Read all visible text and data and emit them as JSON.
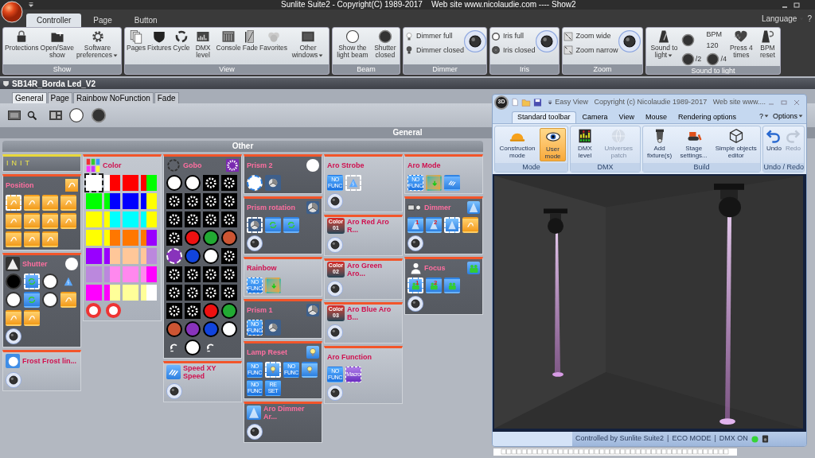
{
  "app": {
    "title": "Sunlite Suite2 - Copyright(C) 1989-2017    Web site www.nicolaudie.com ---- Show2"
  },
  "ribbon": {
    "tabs": [
      {
        "label": "Controller",
        "selected": true
      },
      {
        "label": "Page",
        "selected": false
      },
      {
        "label": "Button",
        "selected": false
      }
    ],
    "language": "Language",
    "help": "?",
    "groups": [
      {
        "label": "Show",
        "items": [
          {
            "kind": "button",
            "label": "Protections"
          },
          {
            "kind": "button",
            "label": "Open/Save show"
          },
          {
            "kind": "button",
            "label": "Software preferences",
            "dropdown": true
          }
        ]
      },
      {
        "label": "View",
        "items": [
          {
            "kind": "button",
            "label": "Pages"
          },
          {
            "kind": "button",
            "label": "Fixtures"
          },
          {
            "kind": "button",
            "label": "Cycle"
          },
          {
            "kind": "button",
            "label": "DMX level"
          },
          {
            "kind": "button",
            "label": "Console"
          },
          {
            "kind": "button",
            "label": "Fade"
          },
          {
            "kind": "button",
            "label": "Favorites"
          },
          {
            "kind": "button",
            "label": "Other windows",
            "dropdown": true
          }
        ]
      },
      {
        "label": "Beam",
        "items": [
          {
            "kind": "button",
            "label": "Show the light beam"
          },
          {
            "kind": "button",
            "label": "Shutter closed"
          }
        ]
      },
      {
        "label": "Dimmer",
        "items": [
          {
            "kind": "rows",
            "rows": [
              "Dimmer full",
              "Dimmer closed"
            ]
          },
          {
            "kind": "knob"
          }
        ]
      },
      {
        "label": "Iris",
        "items": [
          {
            "kind": "rows",
            "rows": [
              "Iris full",
              "Iris closed"
            ]
          },
          {
            "kind": "knob"
          }
        ]
      },
      {
        "label": "Zoom",
        "items": [
          {
            "kind": "rows",
            "rows": [
              "Zoom wide",
              "Zoom narrow"
            ]
          },
          {
            "kind": "knob"
          }
        ]
      },
      {
        "label": "Sound to light",
        "items": [
          {
            "kind": "button",
            "label": "Sound to light",
            "dropdown": true
          },
          {
            "kind": "beat",
            "bpm": "BPM 120",
            "half": "/2",
            "quarter": "/4"
          },
          {
            "kind": "button",
            "label": "Press 4 times"
          },
          {
            "kind": "button",
            "label": "BPM reset"
          }
        ]
      }
    ]
  },
  "document": {
    "title": "SB14R_Borda Led_V2",
    "tabs": [
      {
        "label": "General",
        "selected": true
      },
      {
        "label": "Page",
        "selected": false
      },
      {
        "label": "Rainbow NoFunction",
        "selected": false
      },
      {
        "label": "Fade",
        "selected": false
      }
    ],
    "section": "General",
    "group": "Other",
    "columns": [
      [
        {
          "kind": "label",
          "title": "INIT"
        },
        {
          "kind": "panel",
          "title": "Position",
          "highlighted": true,
          "knob": false,
          "items": [
            {
              "kind": "orange",
              "selected": true
            },
            {
              "kind": "orange",
              "selected": false
            },
            {
              "kind": "orange",
              "selected": false
            },
            {
              "kind": "orange",
              "selected": false
            },
            {
              "kind": "orange",
              "selected": false
            },
            {
              "kind": "orange",
              "selected": false
            },
            {
              "kind": "orange",
              "selected": false
            },
            {
              "kind": "orange",
              "selected": false
            },
            {
              "kind": "orange",
              "selected": false
            },
            {
              "kind": "orange",
              "selected": false
            },
            {
              "kind": "orange",
              "selected": false
            }
          ]
        },
        {
          "kind": "panel",
          "title": "Shutter",
          "highlighted": true,
          "knob": true,
          "items": [
            {
              "kind": "black",
              "selected": false
            },
            {
              "kind": "cycle",
              "selected": true
            },
            {
              "kind": "white",
              "selected": false
            },
            {
              "kind": "flash",
              "selected": false
            },
            {
              "kind": "white",
              "selected": false
            },
            {
              "kind": "cycle",
              "selected": false
            },
            {
              "kind": "white",
              "selected": false
            },
            {
              "kind": "orange",
              "selected": false
            },
            {
              "kind": "orange",
              "selected": false
            },
            {
              "kind": "orange",
              "selected": false
            }
          ]
        },
        {
          "kind": "panel",
          "title": "Frost Frost lin...",
          "highlighted": false,
          "knob": true
        }
      ],
      [
        {
          "kind": "panel",
          "title": "Color",
          "highlighted": false,
          "knob": false,
          "items": [
            {
              "kind": "swatch",
              "color": "#ffffff",
              "selected": true
            },
            {
              "kind": "split",
              "color": "#ff0000",
              "selected": false
            },
            {
              "kind": "swatch",
              "color": "#ff0000",
              "selected": false
            },
            {
              "kind": "split",
              "color": "#00ff00",
              "selected": false
            },
            {
              "kind": "swatch",
              "color": "#00ff00",
              "selected": false
            },
            {
              "kind": "split",
              "color": "#0000ff",
              "selected": false
            },
            {
              "kind": "swatch",
              "color": "#0000ff",
              "selected": false
            },
            {
              "kind": "split",
              "color": "#ffff00",
              "selected": false
            },
            {
              "kind": "swatch",
              "color": "#ffff00",
              "selected": false
            },
            {
              "kind": "split",
              "color": "#00ffff",
              "selected": false
            },
            {
              "kind": "swatch",
              "color": "#00ffff",
              "selected": false
            },
            {
              "kind": "split",
              "color": "#ffff00",
              "selected": false
            },
            {
              "kind": "swatch",
              "color": "#ffff00",
              "selected": false
            },
            {
              "kind": "split",
              "color": "#ff7700",
              "selected": false
            },
            {
              "kind": "swatch",
              "color": "#ff7700",
              "selected": false
            },
            {
              "kind": "split",
              "color": "#9900ff",
              "selected": false
            },
            {
              "kind": "swatch",
              "color": "#9900ff",
              "selected": false
            },
            {
              "kind": "split",
              "color": "#ffc799",
              "selected": false
            },
            {
              "kind": "swatch",
              "color": "#ffc799",
              "selected": false
            },
            {
              "kind": "split",
              "color": "#bb88dd",
              "selected": false
            },
            {
              "kind": "swatch",
              "color": "#bb88dd",
              "selected": false
            },
            {
              "kind": "split",
              "color": "#ff88ee",
              "selected": false
            },
            {
              "kind": "swatch",
              "color": "#ff88ee",
              "selected": false
            },
            {
              "kind": "split",
              "color": "#ff00ff",
              "selected": false
            },
            {
              "kind": "swatch",
              "color": "#ff00ff",
              "selected": false
            },
            {
              "kind": "split",
              "color": "#ffff99",
              "selected": false
            },
            {
              "kind": "swatch",
              "color": "#ffff99",
              "selected": false
            },
            {
              "kind": "split",
              "color": "#ffffff",
              "selected": false
            },
            {
              "kind": "rainbow",
              "selected": false
            },
            {
              "kind": "rainbow",
              "selected": false
            }
          ]
        }
      ],
      [
        {
          "kind": "panel",
          "title": "Gobo",
          "highlighted": true,
          "knob": false,
          "items": [
            {
              "kind": "disc",
              "color": "#ffffff",
              "selected": false
            },
            {
              "kind": "disc",
              "color": "#ffffff",
              "selected": false
            },
            {
              "kind": "pattern",
              "selected": false
            },
            {
              "kind": "pattern",
              "selected": false
            },
            {
              "kind": "pattern",
              "selected": false
            },
            {
              "kind": "pattern",
              "selected": false
            },
            {
              "kind": "pattern",
              "selected": false
            },
            {
              "kind": "pattern",
              "selected": false
            },
            {
              "kind": "pattern",
              "selected": false
            },
            {
              "kind": "pattern",
              "selected": false
            },
            {
              "kind": "pattern",
              "selected": false
            },
            {
              "kind": "pattern",
              "selected": false
            },
            {
              "kind": "pattern",
              "selected": false
            },
            {
              "kind": "disc",
              "color": "#ee1111",
              "selected": false
            },
            {
              "kind": "disc",
              "color": "#22aa33",
              "selected": false
            },
            {
              "kind": "disc",
              "color": "#cc5533",
              "selected": false
            },
            {
              "kind": "disc",
              "color": "#8833bb",
              "selected": true
            },
            {
              "kind": "disc",
              "color": "#1144dd",
              "selected": false
            },
            {
              "kind": "disc",
              "color": "#ffffff",
              "selected": false
            },
            {
              "kind": "pattern",
              "selected": false
            },
            {
              "kind": "pattern",
              "selected": false
            },
            {
              "kind": "pattern",
              "selected": false
            },
            {
              "kind": "pattern",
              "selected": false
            },
            {
              "kind": "pattern",
              "selected": false
            },
            {
              "kind": "pattern",
              "selected": false
            },
            {
              "kind": "pattern",
              "selected": false
            },
            {
              "kind": "pattern",
              "selected": false
            },
            {
              "kind": "pattern",
              "selected": false
            },
            {
              "kind": "pattern",
              "selected": false
            },
            {
              "kind": "pattern",
              "selected": false
            },
            {
              "kind": "disc",
              "color": "#ee1111",
              "selected": false
            },
            {
              "kind": "disc",
              "color": "#22aa33",
              "selected": false
            },
            {
              "kind": "disc",
              "color": "#cc5533",
              "selected": false
            },
            {
              "kind": "disc",
              "color": "#8833bb",
              "selected": false
            },
            {
              "kind": "disc",
              "color": "#1144dd",
              "selected": false
            },
            {
              "kind": "disc",
              "color": "#ffffff",
              "selected": false
            },
            {
              "kind": "rotate",
              "selected": false
            },
            {
              "kind": "disc",
              "color": "#ffffff",
              "selected": false
            },
            {
              "kind": "rotate",
              "selected": false
            }
          ]
        },
        {
          "kind": "panel",
          "title": "Speed XY Speed",
          "highlighted": false,
          "knob": true
        }
      ],
      [
        {
          "kind": "panel",
          "title": "Prism 2",
          "highlighted": true,
          "knob": false,
          "items": [
            {
              "kind": "white",
              "selected": true
            },
            {
              "kind": "prism",
              "selected": false
            }
          ]
        },
        {
          "kind": "panel",
          "title": "Prism rotation",
          "highlighted": true,
          "knob": true,
          "items": [
            {
              "kind": "prism",
              "selected": true
            },
            {
              "kind": "cycle",
              "selected": false
            },
            {
              "kind": "cycle",
              "selected": false
            }
          ]
        },
        {
          "kind": "panel",
          "title": "Rainbow",
          "highlighted": false,
          "knob": false,
          "items": [
            {
              "kind": "nofunc",
              "label": "NO FUNC",
              "selected": true
            },
            {
              "kind": "gradient",
              "selected": false
            }
          ]
        },
        {
          "kind": "panel",
          "title": "Prism 1",
          "highlighted": true,
          "knob": false,
          "items": [
            {
              "kind": "nofunc",
              "label": "NO FUNC",
              "selected": true
            },
            {
              "kind": "prism",
              "selected": false
            }
          ]
        },
        {
          "kind": "panel",
          "title": "Lamp Reset",
          "highlighted": true,
          "knob": false,
          "items": [
            {
              "kind": "nofunc",
              "label": "NO FUNC",
              "selected": false
            },
            {
              "kind": "bulb",
              "selected": true
            },
            {
              "kind": "nofunc",
              "label": "NO FUNC",
              "selected": false
            },
            {
              "kind": "bulb",
              "selected": false
            },
            {
              "kind": "nofunc",
              "label": "NO FUNC",
              "selected": false
            },
            {
              "kind": "nofunc",
              "label": "RE SET",
              "selected": false
            }
          ]
        },
        {
          "kind": "panel",
          "title": "Aro Dimmer Ar...",
          "highlighted": true,
          "knob": true
        }
      ],
      [
        {
          "kind": "panel",
          "title": "Aro Strobe",
          "highlighted": false,
          "knob": true,
          "items": [
            {
              "kind": "nofunc",
              "label": "NO FUNC",
              "selected": false
            },
            {
              "kind": "flash",
              "selected": true
            }
          ]
        },
        {
          "kind": "panel",
          "title": "Aro Red Aro R...",
          "highlighted": false,
          "chip_label": "Color 01",
          "knob": true
        },
        {
          "kind": "panel",
          "title": "Aro Green Aro...",
          "highlighted": false,
          "chip_label": "Color 02",
          "knob": true
        },
        {
          "kind": "panel",
          "title": "Aro Blue Aro B...",
          "highlighted": false,
          "chip_label": "Color 03",
          "knob": true
        },
        {
          "kind": "panel",
          "title": "Aro Function",
          "highlighted": false,
          "knob": true,
          "items": [
            {
              "kind": "nofunc",
              "label": "NO FUNC",
              "selected": false
            },
            {
              "kind": "macro",
              "label": "Macro",
              "selected": true
            }
          ]
        }
      ],
      [
        {
          "kind": "panel",
          "title": "Aro Mode",
          "highlighted": false,
          "knob": false,
          "items": [
            {
              "kind": "nofunc",
              "label": "NO FUNC",
              "selected": true
            },
            {
              "kind": "gradient",
              "selected": false
            },
            {
              "kind": "layers",
              "selected": false
            }
          ]
        },
        {
          "kind": "panel",
          "title": "Dimmer",
          "highlighted": true,
          "knob": true,
          "items": [
            {
              "kind": "beam",
              "label": "1",
              "selected": false
            },
            {
              "kind": "beam",
              "label": "2",
              "selected": false
            },
            {
              "kind": "beam",
              "selected": true
            },
            {
              "kind": "orange",
              "selected": false
            }
          ]
        },
        {
          "kind": "panel",
          "title": "Focus",
          "highlighted": true,
          "knob": true,
          "items": [
            {
              "kind": "people",
              "label": "1",
              "selected": true
            },
            {
              "kind": "people",
              "label": "2",
              "selected": false
            },
            {
              "kind": "people",
              "selected": false
            }
          ]
        }
      ]
    ]
  },
  "easy_view": {
    "orb": "3D",
    "title": "Easy View   Copyright (c) Nicolaudie 1989-2017   Web site www....",
    "tabs": [
      {
        "label": "Standard toolbar",
        "selected": true
      },
      {
        "label": "Camera",
        "selected": false
      },
      {
        "label": "View",
        "selected": false
      },
      {
        "label": "Mouse",
        "selected": false
      },
      {
        "label": "Rendering options",
        "selected": false
      }
    ],
    "help": "?",
    "options": "Options",
    "groups": [
      {
        "label": "Mode",
        "items": [
          {
            "label": "Construction mode",
            "selected": false
          },
          {
            "label": "User mode",
            "selected": true
          }
        ]
      },
      {
        "label": "DMX",
        "items": [
          {
            "label": "DMX level",
            "disabled": false
          },
          {
            "label": "Universes patch",
            "disabled": true
          }
        ]
      },
      {
        "label": "Build",
        "items": [
          {
            "label": "Add fixture(s)"
          },
          {
            "label": "Stage settings..."
          },
          {
            "label": "Simple objects editor"
          }
        ]
      },
      {
        "label": "Undo / Redo",
        "items": [
          {
            "label": "Undo",
            "disabled": false
          },
          {
            "label": "Redo",
            "disabled": true
          }
        ]
      }
    ],
    "status_bar": [
      "Controlled by Sunlite Suite2",
      "|",
      "ECO MODE",
      "|",
      "DMX ON"
    ]
  }
}
